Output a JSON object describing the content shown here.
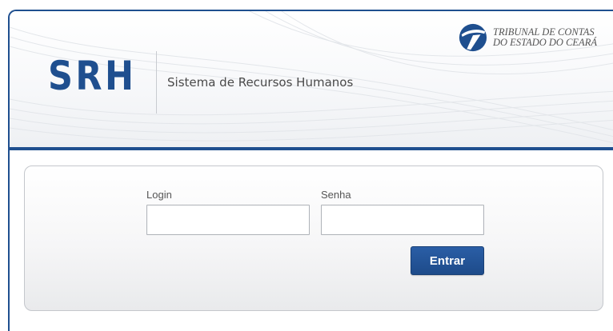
{
  "header": {
    "brand": "SRH",
    "subtitle": "Sistema de Recursos Humanos",
    "organization": {
      "line1": "TRIBUNAL DE CONTAS",
      "line2": "DO ESTADO DO CEARÁ",
      "logo_icon": "tce-ceara-logo-icon"
    }
  },
  "login_form": {
    "login_label": "Login",
    "login_value": "",
    "password_label": "Senha",
    "password_value": "",
    "submit_label": "Entrar"
  },
  "colors": {
    "brand_blue": "#1f4f8f",
    "button_blue": "#1e4b8a"
  }
}
